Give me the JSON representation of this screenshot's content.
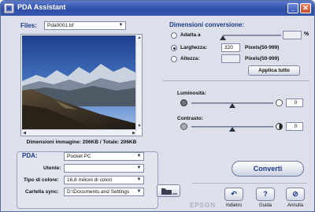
{
  "window": {
    "title": "PDA Assistant",
    "minimize_glyph": "_",
    "close_glyph": "✕"
  },
  "files": {
    "label": "Files:",
    "selected": "Pda0001.bf"
  },
  "image_info": "Dimensioni immagine: 206KB / Totale: 206KB",
  "conversion": {
    "title": "Dimensioni conversione:",
    "adatta_label": "Adatta a",
    "adatta_value": "",
    "percent_unit": "%",
    "larghezza_label": "Larghezza:",
    "larghezza_value": "320",
    "larghezza_unit": "Pixels(50-999)",
    "altezza_label": "Altezza:",
    "altezza_value": "",
    "altezza_unit": "Pixels(50-999)",
    "apply_all": "Applica tutto"
  },
  "adjust": {
    "luminosita_label": "Luminosità:",
    "luminosita_value": "0",
    "contrasto_label": "Contrasto:",
    "contrasto_value": "0"
  },
  "pda": {
    "label": "PDA:",
    "model": "Pocket PC",
    "utente_label": "Utente:",
    "utente_value": "",
    "colori_label": "Tipo di colore:",
    "colori_value": "16,8 milioni di colori",
    "sync_label": "Cartella sync:",
    "sync_value": "D:\\Documents and Settings"
  },
  "actions": {
    "converti": "Converti",
    "indietro": "Indietro",
    "guida": "Guida",
    "annulla": "Annulla"
  },
  "brand": "EPSON",
  "colors": {
    "titlebar": "#2f4fa8",
    "accent_text": "#1c3a8a",
    "background": "#dde0ea"
  }
}
